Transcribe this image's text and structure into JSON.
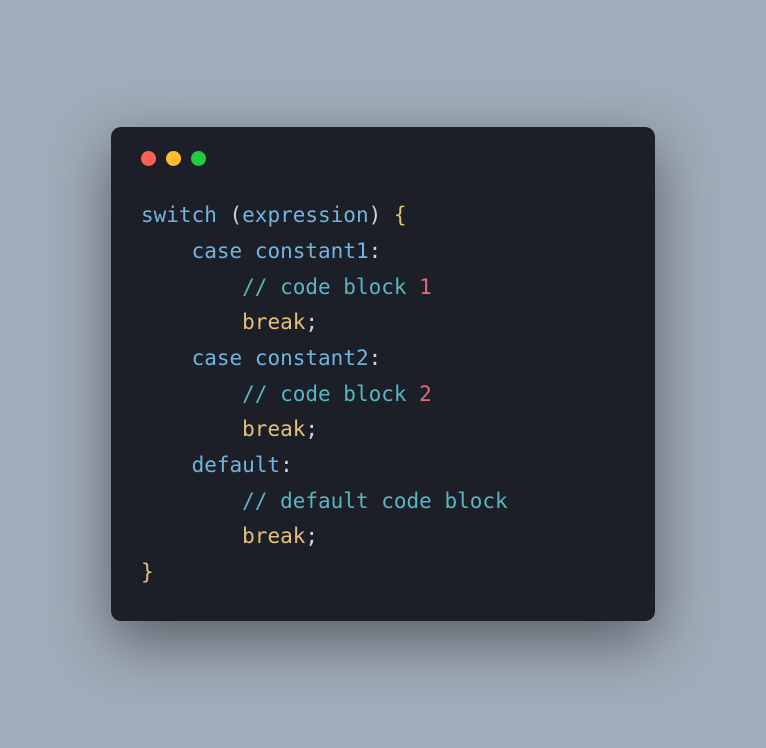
{
  "code": {
    "line1": {
      "switch_kw": "switch",
      "open_paren": " (",
      "expr": "expression",
      "close_paren": ") ",
      "open_brace": "{"
    },
    "line2": {
      "indent": "    ",
      "case_kw": "case",
      "space": " ",
      "const": "constant1",
      "colon": ":"
    },
    "line3": {
      "indent": "        ",
      "comment_prefix": "// code block ",
      "num": "1"
    },
    "line4": {
      "indent": "        ",
      "break_kw": "break",
      "semi": ";"
    },
    "line5": {
      "indent": "    ",
      "case_kw": "case",
      "space": " ",
      "const": "constant2",
      "colon": ":"
    },
    "line6": {
      "indent": "        ",
      "comment_prefix": "// code block ",
      "num": "2"
    },
    "line7": {
      "indent": "        ",
      "break_kw": "break",
      "semi": ";"
    },
    "line8": {
      "indent": "    ",
      "default_kw": "default",
      "colon": ":"
    },
    "line9": {
      "indent": "        ",
      "comment": "// default code block"
    },
    "line10": {
      "indent": "        ",
      "break_kw": "break",
      "semi": ";"
    },
    "line11": {
      "close_brace": "}"
    }
  }
}
